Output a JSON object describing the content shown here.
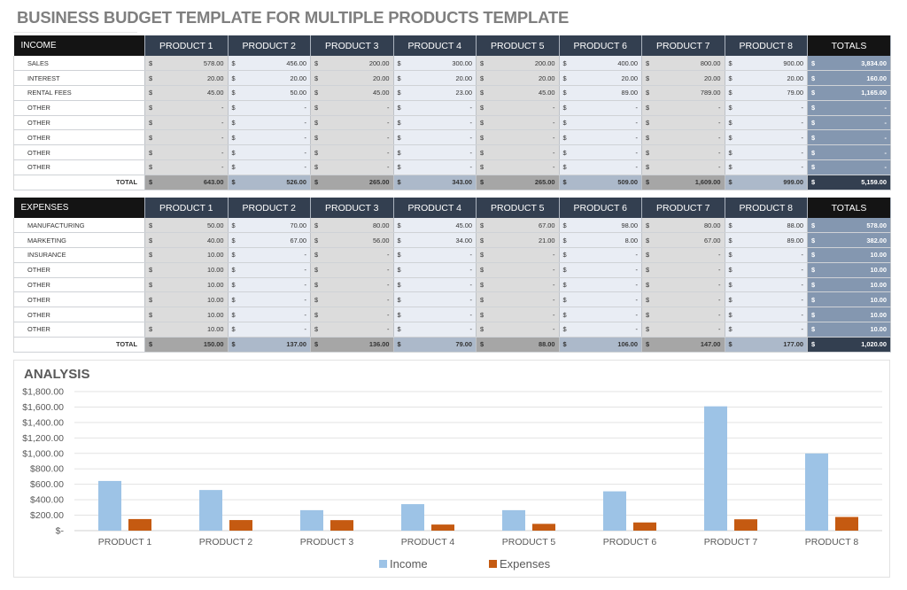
{
  "title": "BUSINESS BUDGET TEMPLATE FOR MULTIPLE PRODUCTS TEMPLATE",
  "columns": [
    "PRODUCT 1",
    "PRODUCT 2",
    "PRODUCT 3",
    "PRODUCT 4",
    "PRODUCT 5",
    "PRODUCT 6",
    "PRODUCT 7",
    "PRODUCT 8"
  ],
  "totals_header": "TOTALS",
  "currency_symbol": "$",
  "income": {
    "header": "INCOME",
    "rows": [
      {
        "label": "SALES",
        "values": [
          "578.00",
          "456.00",
          "200.00",
          "300.00",
          "200.00",
          "400.00",
          "800.00",
          "900.00"
        ],
        "total": "3,834.00"
      },
      {
        "label": "INTEREST",
        "values": [
          "20.00",
          "20.00",
          "20.00",
          "20.00",
          "20.00",
          "20.00",
          "20.00",
          "20.00"
        ],
        "total": "160.00"
      },
      {
        "label": "RENTAL FEES",
        "values": [
          "45.00",
          "50.00",
          "45.00",
          "23.00",
          "45.00",
          "89.00",
          "789.00",
          "79.00"
        ],
        "total": "1,165.00"
      },
      {
        "label": "OTHER",
        "values": [
          "-",
          "-",
          "-",
          "-",
          "-",
          "-",
          "-",
          "-"
        ],
        "total": "-"
      },
      {
        "label": "OTHER",
        "values": [
          "-",
          "-",
          "-",
          "-",
          "-",
          "-",
          "-",
          "-"
        ],
        "total": "-"
      },
      {
        "label": "OTHER",
        "values": [
          "-",
          "-",
          "-",
          "-",
          "-",
          "-",
          "-",
          "-"
        ],
        "total": "-"
      },
      {
        "label": "OTHER",
        "values": [
          "-",
          "-",
          "-",
          "-",
          "-",
          "-",
          "-",
          "-"
        ],
        "total": "-"
      },
      {
        "label": "OTHER",
        "values": [
          "-",
          "-",
          "-",
          "-",
          "-",
          "-",
          "-",
          "-"
        ],
        "total": "-"
      }
    ],
    "total_row": {
      "label": "TOTAL",
      "values": [
        "643.00",
        "526.00",
        "265.00",
        "343.00",
        "265.00",
        "509.00",
        "1,609.00",
        "999.00"
      ],
      "total": "5,159.00"
    }
  },
  "expenses": {
    "header": "EXPENSES",
    "rows": [
      {
        "label": "MANUFACTURING",
        "values": [
          "50.00",
          "70.00",
          "80.00",
          "45.00",
          "67.00",
          "98.00",
          "80.00",
          "88.00"
        ],
        "total": "578.00"
      },
      {
        "label": "MARKETING",
        "values": [
          "40.00",
          "67.00",
          "56.00",
          "34.00",
          "21.00",
          "8.00",
          "67.00",
          "89.00"
        ],
        "total": "382.00"
      },
      {
        "label": "INSURANCE",
        "values": [
          "10.00",
          "-",
          "-",
          "-",
          "-",
          "-",
          "-",
          "-"
        ],
        "total": "10.00"
      },
      {
        "label": "OTHER",
        "values": [
          "10.00",
          "-",
          "-",
          "-",
          "-",
          "-",
          "-",
          "-"
        ],
        "total": "10.00"
      },
      {
        "label": "OTHER",
        "values": [
          "10.00",
          "-",
          "-",
          "-",
          "-",
          "-",
          "-",
          "-"
        ],
        "total": "10.00"
      },
      {
        "label": "OTHER",
        "values": [
          "10.00",
          "-",
          "-",
          "-",
          "-",
          "-",
          "-",
          "-"
        ],
        "total": "10.00"
      },
      {
        "label": "OTHER",
        "values": [
          "10.00",
          "-",
          "-",
          "-",
          "-",
          "-",
          "-",
          "-"
        ],
        "total": "10.00"
      },
      {
        "label": "OTHER",
        "values": [
          "10.00",
          "-",
          "-",
          "-",
          "-",
          "-",
          "-",
          "-"
        ],
        "total": "10.00"
      }
    ],
    "total_row": {
      "label": "TOTAL",
      "values": [
        "150.00",
        "137.00",
        "136.00",
        "79.00",
        "88.00",
        "106.00",
        "147.00",
        "177.00"
      ],
      "total": "1,020.00"
    }
  },
  "colors": {
    "income_bar": "#9dc3e6",
    "expenses_bar": "#c55a11",
    "header_dark": "#333f50",
    "header_black": "#141414",
    "totals_col": "#8497b0"
  },
  "chart_data": {
    "type": "bar",
    "title": "ANALYSIS",
    "categories": [
      "PRODUCT 1",
      "PRODUCT 2",
      "PRODUCT 3",
      "PRODUCT 4",
      "PRODUCT 5",
      "PRODUCT 6",
      "PRODUCT 7",
      "PRODUCT 8"
    ],
    "series": [
      {
        "name": "Income",
        "values": [
          643,
          526,
          265,
          343,
          265,
          509,
          1609,
          999
        ]
      },
      {
        "name": "Expenses",
        "values": [
          150,
          137,
          136,
          79,
          88,
          106,
          147,
          177
        ]
      }
    ],
    "xlabel": "",
    "ylabel": "",
    "ylim": [
      0,
      1800
    ],
    "yticks": [
      0,
      200,
      400,
      600,
      800,
      1000,
      1200,
      1400,
      1600,
      1800
    ],
    "ytick_labels": [
      "$-",
      "$200.00",
      "$400.00",
      "$600.00",
      "$800.00",
      "$1,000.00",
      "$1,200.00",
      "$1,400.00",
      "$1,600.00",
      "$1,800.00"
    ],
    "grid": true,
    "legend": "bottom"
  }
}
